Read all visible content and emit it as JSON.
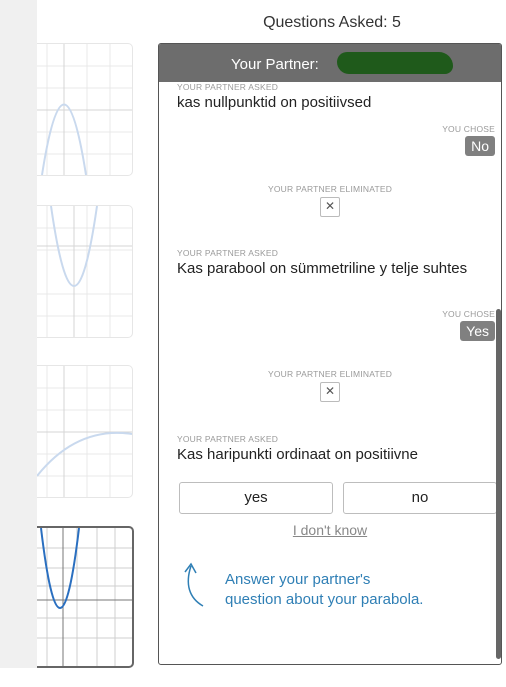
{
  "header": {
    "questions_asked": "Questions Asked: 5"
  },
  "panel": {
    "title": "Your Partner:"
  },
  "conversation": [
    {
      "kind": "asked",
      "caption": "YOUR PARTNER ASKED",
      "text": "kas nullpunktid on positiivsed"
    },
    {
      "kind": "chose",
      "caption": "YOU CHOSE",
      "answer": "No"
    },
    {
      "kind": "eliminated",
      "caption": "YOUR PARTNER ELIMINATED",
      "icon": "x-icon"
    },
    {
      "kind": "asked",
      "caption": "YOUR PARTNER ASKED",
      "text": "Kas parabool on sümmetriline y telje suhtes"
    },
    {
      "kind": "chose",
      "caption": "YOU CHOSE",
      "answer": "Yes"
    },
    {
      "kind": "eliminated",
      "caption": "YOUR PARTNER ELIMINATED",
      "icon": "x-icon"
    },
    {
      "kind": "asked",
      "caption": "YOUR PARTNER ASKED",
      "text": "Kas haripunkti ordinaat on positiivne"
    }
  ],
  "actions": {
    "yes": "yes",
    "no": "no",
    "dont_know": "I don't know"
  },
  "hint": {
    "line1": "Answer your partner's",
    "line2": "question about your parabola.",
    "icon": "arrow-up-icon"
  },
  "colors": {
    "header": "#6d6d6d",
    "accent": "#2f7fb5",
    "badge": "#808080",
    "curve_faded": "#c9d9ee",
    "curve_active": "#2a6fc0"
  },
  "cards": [
    {
      "curve": "downward-parabola",
      "selected": false
    },
    {
      "curve": "upward-parabola",
      "selected": false
    },
    {
      "curve": "rising-curve",
      "selected": false
    },
    {
      "curve": "upward-parabola",
      "selected": true
    }
  ]
}
